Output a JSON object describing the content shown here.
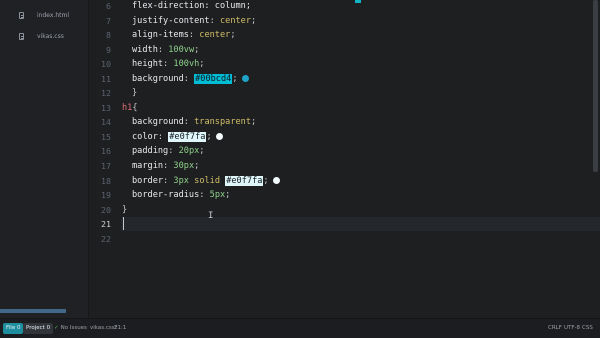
{
  "sidebar": {
    "files": [
      {
        "name": "index.html",
        "icon": "file-icon"
      },
      {
        "name": "vikas.css",
        "icon": "file-icon"
      }
    ]
  },
  "editor": {
    "active_line": 21,
    "line_numbers": [
      "6",
      "7",
      "8",
      "9",
      "10",
      "11",
      "12",
      "13",
      "14",
      "15",
      "16",
      "17",
      "18",
      "19",
      "20",
      "21",
      "22"
    ],
    "code": {
      "l6_text": "flex-direction: column;",
      "l7_prop": "justify-content",
      "l7_val": "center",
      "l8_prop": "align-items",
      "l8_val": "center",
      "l9_prop": "width",
      "l9_num": "100",
      "l9_unit": "vw",
      "l10_prop": "height",
      "l10_num": "100",
      "l10_unit": "vh",
      "l11_prop": "background",
      "l11_val": "#00bcd4",
      "l12": "}",
      "l13_sel": "h1",
      "l13_brace": "{",
      "l14_prop": "background",
      "l14_val": "transparent",
      "l15_prop": "color",
      "l15_val": "#e0f7fa",
      "l16_prop": "padding",
      "l16_num": "20",
      "l16_unit": "px",
      "l17_prop": "margin",
      "l17_num": "30",
      "l17_unit": "px",
      "l18_prop": "border",
      "l18_num": "3",
      "l18_unit": "px",
      "l18_kw": "solid",
      "l18_val": "#e0f7fa",
      "l19_prop": "border-radius",
      "l19_num": "5",
      "l19_unit": "px",
      "l20": "}"
    }
  },
  "colors": {
    "cyan": "#00bcd4",
    "light_cyan": "#e0f7fa"
  },
  "status": {
    "file_badge": "File 0",
    "project_badge": "Project 0",
    "issues": "No Issues",
    "filename": "vikas.css*",
    "cursor_pos": "21:1",
    "line_ending": "CRLF",
    "encoding": "UTF-8",
    "syntax": "CSS"
  }
}
